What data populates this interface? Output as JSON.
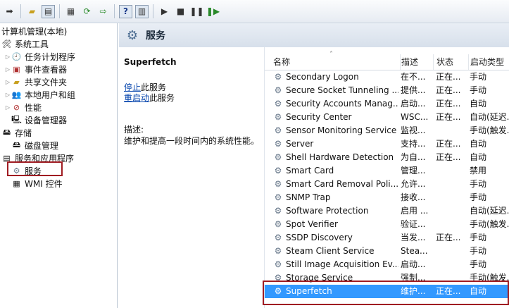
{
  "toolbar": {
    "buttons": [
      "back-icon",
      "up-folder-icon",
      "show-hide-tree-icon",
      "properties-icon",
      "refresh-icon",
      "export-icon",
      "help-icon",
      "show-pane-icon",
      "play-icon",
      "stop-icon",
      "pause-icon",
      "restart-icon"
    ]
  },
  "tree": {
    "root": "计算机管理(本地)",
    "system_tools": "系统工具",
    "task_scheduler": "任务计划程序",
    "event_viewer": "事件查看器",
    "shared_folders": "共享文件夹",
    "local_users": "本地用户和组",
    "performance": "性能",
    "device_manager": "设备管理器",
    "storage": "存储",
    "disk_management": "磁盘管理",
    "services_apps": "服务和应用程序",
    "services": "服务",
    "wmi": "WMI 控件"
  },
  "header": {
    "title": "服务"
  },
  "detail": {
    "service_name": "Superfetch",
    "stop_link": "停止",
    "stop_suffix": "此服务",
    "restart_link": "重启动",
    "restart_suffix": "此服务",
    "desc_label": "描述:",
    "desc_text": "维护和提高一段时间内的系统性能。"
  },
  "columns": {
    "name": "名称",
    "desc": "描述",
    "status": "状态",
    "startup": "启动类型"
  },
  "rows": [
    {
      "name": "Secondary Logon",
      "desc": "在不...",
      "status": "正在...",
      "startup": "手动"
    },
    {
      "name": "Secure Socket Tunneling ...",
      "desc": "提供...",
      "status": "正在...",
      "startup": "手动"
    },
    {
      "name": "Security Accounts Manag...",
      "desc": "启动...",
      "status": "正在...",
      "startup": "自动"
    },
    {
      "name": "Security Center",
      "desc": "WSC...",
      "status": "正在...",
      "startup": "自动(延迟..."
    },
    {
      "name": "Sensor Monitoring Service",
      "desc": "监视...",
      "status": "",
      "startup": "手动(触发..."
    },
    {
      "name": "Server",
      "desc": "支持...",
      "status": "正在...",
      "startup": "自动"
    },
    {
      "name": "Shell Hardware Detection",
      "desc": "为自...",
      "status": "正在...",
      "startup": "自动"
    },
    {
      "name": "Smart Card",
      "desc": "管理...",
      "status": "",
      "startup": "禁用"
    },
    {
      "name": "Smart Card Removal Poli...",
      "desc": "允许...",
      "status": "",
      "startup": "手动"
    },
    {
      "name": "SNMP Trap",
      "desc": "接收...",
      "status": "",
      "startup": "手动"
    },
    {
      "name": "Software Protection",
      "desc": "启用 ...",
      "status": "",
      "startup": "自动(延迟..."
    },
    {
      "name": "Spot Verifier",
      "desc": "验证...",
      "status": "",
      "startup": "手动(触发..."
    },
    {
      "name": "SSDP Discovery",
      "desc": "当发...",
      "status": "正在...",
      "startup": "手动"
    },
    {
      "name": "Steam Client Service",
      "desc": "Stea...",
      "status": "",
      "startup": "手动"
    },
    {
      "name": "Still Image Acquisition Ev...",
      "desc": "启动...",
      "status": "",
      "startup": "手动"
    },
    {
      "name": "Storage Service",
      "desc": "强制...",
      "status": "",
      "startup": "手动(触发..."
    },
    {
      "name": "Superfetch",
      "desc": "维护...",
      "status": "正在...",
      "startup": "自动",
      "selected": true
    }
  ]
}
